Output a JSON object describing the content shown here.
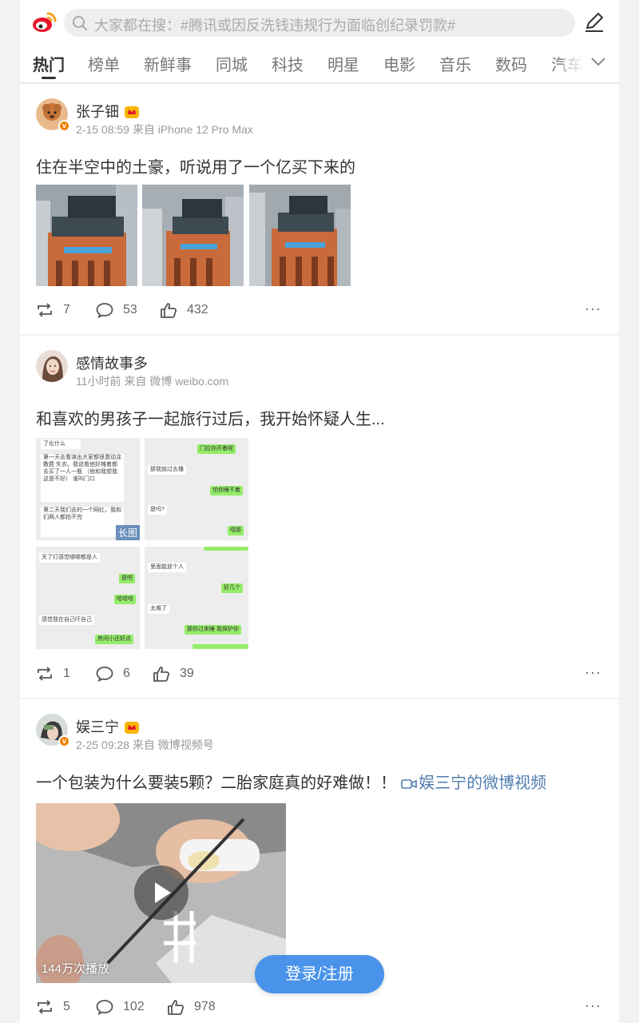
{
  "search": {
    "placeholder": "大家都在搜：#腾讯或因反洗钱违规行为面临创纪录罚款#"
  },
  "tabs": [
    "热门",
    "榜单",
    "新鲜事",
    "同城",
    "科技",
    "明星",
    "电影",
    "音乐",
    "数码",
    "汽车"
  ],
  "active_tab": "热门",
  "posts": [
    {
      "username": "张子钿",
      "meta": "2-15 08:59 来自 iPhone 12 Pro Max",
      "text": "住在半空中的土豪，听说用了一个亿买下来的",
      "reposts": "7",
      "comments": "53",
      "likes": "432"
    },
    {
      "username": "感情故事多",
      "meta": "11小时前 来自 微博 weibo.com",
      "text": "和喜欢的男孩子一起旅行过后，我开始怀疑人生...",
      "long_image_tag": "长图",
      "chat": {
        "img1": [
          "了化什么",
          "第一天去看演出大家都很激动涂敷费 失衣。我说看他好摊着都去买了一人一瓶 （他和我想我这是不好） 谁叫门口",
          "第二天我们去的一个网红，我和 们两人都拍不完"
        ],
        "img2": [
          "门拉你开着呢",
          "那我就过去播",
          "怕你睡不着",
          "是吗?",
          "噎那"
        ],
        "img3": [
          "关了灯感觉哪哪都是人",
          "是吧",
          "哈哈哈",
          "感觉我在自己吓自己",
          "房间小还好点"
        ],
        "img4": [
          "里面能放个人",
          "好几个",
          "太难了",
          "那你过来睡 我保护你"
        ]
      },
      "reposts": "1",
      "comments": "6",
      "likes": "39"
    },
    {
      "username": "娱三宁",
      "meta": "2-25 09:28 来自 微博视频号",
      "text": "一个包装为什么要装5颗？二胎家庭真的好难做！！",
      "video_link": "娱三宁的微博视频",
      "views": "144万次播放",
      "reposts": "5",
      "comments": "102",
      "likes": "978"
    }
  ],
  "login_button": "登录/注册",
  "colors": {
    "link": "#507daf",
    "login": "#4a93ea",
    "badge": "#f08300",
    "weibo_red": "#e6162d"
  }
}
